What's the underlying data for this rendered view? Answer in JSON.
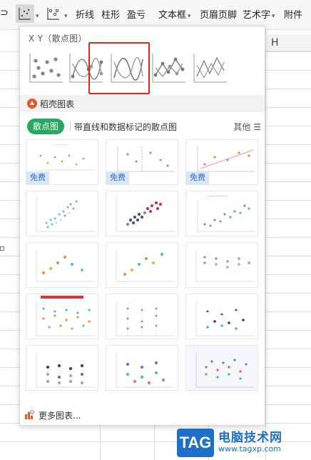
{
  "ribbon": {
    "items": [
      {
        "label": "折线",
        "icon": "line-chart-icon"
      },
      {
        "label": "柱形",
        "icon": "column-chart-icon"
      },
      {
        "label": "盈亏",
        "icon": "win-loss-icon"
      },
      {
        "label": "文本框",
        "icon": "textbox-icon"
      },
      {
        "label": "页眉页脚",
        "icon": "header-footer-icon"
      },
      {
        "label": "艺术字",
        "icon": "wordart-icon"
      },
      {
        "label": "附件",
        "icon": "attachment-icon"
      }
    ]
  },
  "sheet": {
    "column_label": "H"
  },
  "panel": {
    "title": "X Y（散点图）",
    "chart_types": [
      {
        "name": "scatter"
      },
      {
        "name": "scatter-smooth-lines-markers"
      },
      {
        "name": "scatter-smooth-lines"
      },
      {
        "name": "scatter-straight-lines-markers"
      },
      {
        "name": "scatter-straight-lines"
      }
    ],
    "highlighted_index": 2,
    "highlight_color": "#e8211b",
    "section_title": "稻壳图表",
    "filter": {
      "active": "散点图",
      "description": "带直线和数据标记的散点图",
      "other": "其他 ☰"
    },
    "free_label": "免费",
    "accent_color": "#27a760",
    "more_label": "更多图表..."
  },
  "watermark": {
    "tag": "TAG",
    "title": "电脑技术网",
    "url": "www.tagxp.com"
  }
}
